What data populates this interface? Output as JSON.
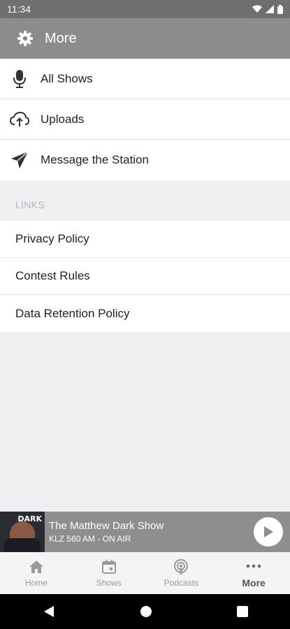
{
  "status_bar": {
    "time": "11:34"
  },
  "app_bar": {
    "title": "More",
    "icon": "gear-icon"
  },
  "menu": [
    {
      "label": "All Shows",
      "icon": "microphone-icon"
    },
    {
      "label": "Uploads",
      "icon": "cloud-upload-icon"
    },
    {
      "label": "Message the Station",
      "icon": "send-icon"
    }
  ],
  "links": {
    "header": "LINKS",
    "items": [
      "Privacy Policy",
      "Contest Rules",
      "Data Retention Policy"
    ]
  },
  "player": {
    "show_title": "The Matthew Dark Show",
    "station": "KLZ 560 AM - ON AIR",
    "art_text": "DARK"
  },
  "tabs": [
    {
      "label": "Home",
      "icon": "home-icon"
    },
    {
      "label": "Shows",
      "icon": "calendar-icon"
    },
    {
      "label": "Podcasts",
      "icon": "podcast-icon"
    },
    {
      "label": "More",
      "icon": "more-dots-icon",
      "active": true
    }
  ],
  "colors": {
    "app_bar": "#8c8c8c",
    "status_bar": "#6f6f6f",
    "background": "#efeff4",
    "player": "#8e8e8e"
  }
}
